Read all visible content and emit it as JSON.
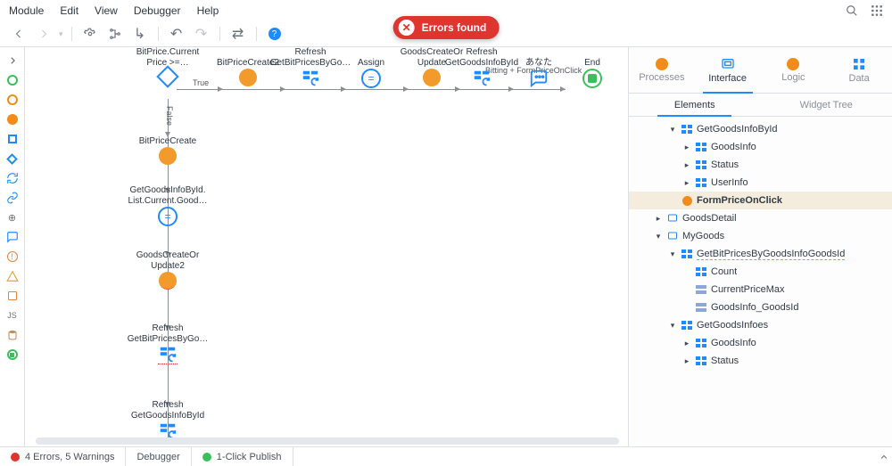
{
  "menu": {
    "items": [
      "Module",
      "Edit",
      "View",
      "Debugger",
      "Help"
    ]
  },
  "toolbar": {
    "errors_badge": "Errors found"
  },
  "status": {
    "errors": "4 Errors, 5 Warnings",
    "debugger": "Debugger",
    "publish": "1-Click Publish"
  },
  "panel": {
    "tabs": {
      "processes": "Processes",
      "interface": "Interface",
      "logic": "Logic",
      "data": "Data"
    },
    "subtabs": {
      "elements": "Elements",
      "widget_tree": "Widget Tree"
    }
  },
  "tree": [
    {
      "indent": 44,
      "caret": "down",
      "icon": "struct",
      "label": "GetGoodsInfoById",
      "style": ""
    },
    {
      "indent": 60,
      "caret": "right",
      "icon": "struct",
      "label": "GoodsInfo",
      "style": ""
    },
    {
      "indent": 60,
      "caret": "right",
      "icon": "struct",
      "label": "Status",
      "style": ""
    },
    {
      "indent": 60,
      "caret": "right",
      "icon": "struct",
      "label": "UserInfo",
      "style": ""
    },
    {
      "indent": 44,
      "caret": "",
      "icon": "action",
      "label": "FormPriceOnClick",
      "style": "selected"
    },
    {
      "indent": 28,
      "caret": "right",
      "icon": "screen",
      "label": "GoodsDetail",
      "style": ""
    },
    {
      "indent": 28,
      "caret": "down",
      "icon": "screen",
      "label": "MyGoods",
      "style": ""
    },
    {
      "indent": 44,
      "caret": "down",
      "icon": "struct",
      "label": "GetBitPricesByGoodsInfoGoodsId",
      "style": "wavy"
    },
    {
      "indent": 60,
      "caret": "",
      "icon": "struct",
      "label": "Count",
      "style": ""
    },
    {
      "indent": 60,
      "caret": "",
      "icon": "attr",
      "label": "CurrentPriceMax",
      "style": ""
    },
    {
      "indent": 60,
      "caret": "",
      "icon": "attr",
      "label": "GoodsInfo_GoodsId",
      "style": ""
    },
    {
      "indent": 44,
      "caret": "down",
      "icon": "struct",
      "label": "GetGoodsInfoes",
      "style": ""
    },
    {
      "indent": 60,
      "caret": "right",
      "icon": "struct",
      "label": "GoodsInfo",
      "style": ""
    },
    {
      "indent": 60,
      "caret": "right",
      "icon": "struct",
      "label": "Status",
      "style": ""
    }
  ],
  "flow": {
    "top_row": [
      {
        "id": "if",
        "label": "BitPrice.Current\nPrice >=…",
        "kind": "diamond"
      },
      {
        "id": "bp1",
        "label": "BitPriceCreate2",
        "kind": "orange"
      },
      {
        "id": "ref1",
        "label": "Refresh\nGetBitPricesByGo…",
        "kind": "refresh"
      },
      {
        "id": "assign",
        "label": "Assign",
        "kind": "bluering",
        "glyph": "="
      },
      {
        "id": "cru",
        "label": "GoodsCreateOr\nUpdate",
        "kind": "orange"
      },
      {
        "id": "ref2",
        "label": "Refresh\nGetGoodsInfoById",
        "kind": "refresh"
      },
      {
        "id": "msg",
        "label": "あなた",
        "kind": "msg"
      },
      {
        "id": "end",
        "label": "End",
        "kind": "end"
      }
    ],
    "top_overlay": "Bitting + FormPriceOnClick",
    "edge_true": "True",
    "edge_false": "False",
    "vcol": [
      {
        "label": "BitPriceCreate",
        "kind": "orange"
      },
      {
        "label": "GetGoodsInfoById.\nList.Current.Good…",
        "kind": "bluering",
        "glyph": "="
      },
      {
        "label": "GoodsCreateOr\nUpdate2",
        "kind": "orange",
        "err": true
      },
      {
        "label": "Refresh\nGetBitPricesByGo…",
        "kind": "refresh",
        "err": true
      },
      {
        "label": "Refresh\nGetGoodsInfoById",
        "kind": "refresh",
        "err": true
      }
    ]
  }
}
